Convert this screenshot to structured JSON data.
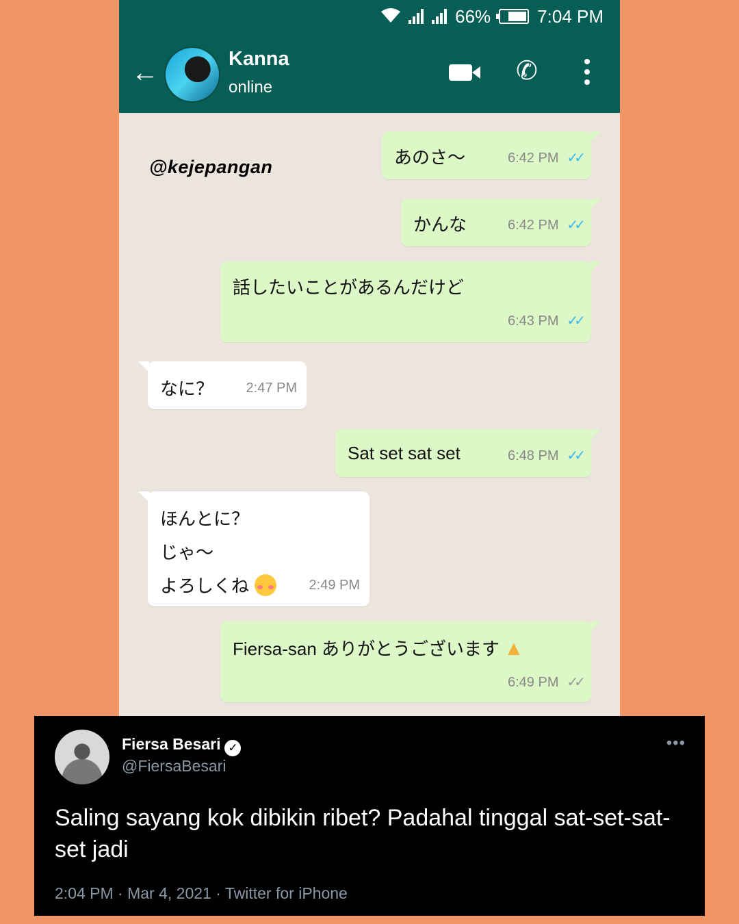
{
  "status_bar": {
    "battery": "66%",
    "time": "7:04 PM"
  },
  "header": {
    "contact_name": "Kanna",
    "contact_status": "online"
  },
  "watermark": "@kejepangan",
  "messages": [
    {
      "dir": "out",
      "text": "あのさ〜",
      "time": "6:42 PM",
      "ticks": "read"
    },
    {
      "dir": "out",
      "text": "かんな",
      "time": "6:42 PM",
      "ticks": "read"
    },
    {
      "dir": "out",
      "text": "話したいことがあるんだけど",
      "time": "6:43 PM",
      "ticks": "read"
    },
    {
      "dir": "in",
      "text": "なに？",
      "time": "2:47 PM"
    },
    {
      "dir": "out",
      "text": "Sat set sat set",
      "time": "6:48 PM",
      "ticks": "read"
    },
    {
      "dir": "in",
      "lines": [
        "ほんとに？",
        "じゃ〜",
        "よろしくね"
      ],
      "emoji": "smiling-face-with-hearts",
      "time": "2:49 PM"
    },
    {
      "dir": "out",
      "text": "Fiersa-san ありがとうございます",
      "emoji": "folded-hands",
      "time": "6:49 PM",
      "ticks": "delivered"
    }
  ],
  "tweet": {
    "name": "Fiersa Besari",
    "handle": "@FiersaBesari",
    "text": "Saling sayang kok dibikin ribet? Padahal tinggal sat-set-sat-set jadi",
    "meta": "2:04 PM · Mar 4, 2021 · Twitter for iPhone"
  },
  "colors": {
    "page_background": "#F19564",
    "header_green": "#075E54",
    "chat_background": "#ECE5DD",
    "outgoing_bubble": "#DCF8C6",
    "incoming_bubble": "#FFFFFF",
    "read_tick": "#34B7F1",
    "tweet_background": "#000000"
  }
}
